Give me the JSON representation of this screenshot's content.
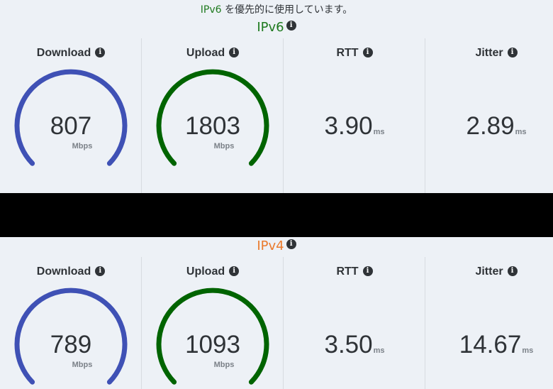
{
  "banner": {
    "protocol": "IPv6",
    "text": " を優先的に使用しています。"
  },
  "icons": {
    "info": "info-icon",
    "info_glyph": "i"
  },
  "colors": {
    "download": "#3f51b5",
    "upload": "#006400",
    "ipv6": "#1f7a1f",
    "ipv4": "#ea7a2c"
  },
  "ipv6": {
    "title": "IPv6",
    "download": {
      "label": "Download",
      "value": "807",
      "unit": "Mbps"
    },
    "upload": {
      "label": "Upload",
      "value": "1803",
      "unit": "Mbps"
    },
    "rtt": {
      "label": "RTT",
      "value": "3.90",
      "unit": "ms"
    },
    "jitter": {
      "label": "Jitter",
      "value": "2.89",
      "unit": "ms"
    }
  },
  "ipv4": {
    "title": "IPv4",
    "download": {
      "label": "Download",
      "value": "789",
      "unit": "Mbps"
    },
    "upload": {
      "label": "Upload",
      "value": "1093",
      "unit": "Mbps"
    },
    "rtt": {
      "label": "RTT",
      "value": "3.50",
      "unit": "ms"
    },
    "jitter": {
      "label": "Jitter",
      "value": "14.67",
      "unit": "ms"
    }
  }
}
